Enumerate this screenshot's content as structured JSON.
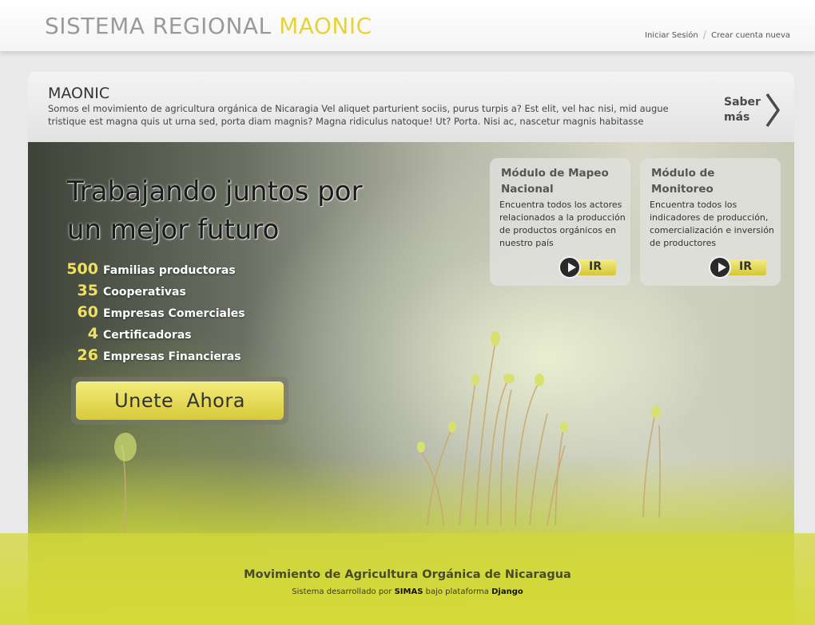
{
  "header": {
    "title_part1": "SISTEMA REGIONAL",
    "title_part2": "MAONIC",
    "login_label": "Iniciar Sesión",
    "signup_label": "Crear cuenta nueva"
  },
  "intro": {
    "title": "MAONIC",
    "text": "Somos el movimiento de agricultura orgánica de Nicaragia Vel aliquet parturient sociis, purus turpis a? Est elit, vel hac nisi, mid augue tristique est magna quis ut urna sed, porta diam magnis? Magna ridiculus natoque! Ut? Porta. Nisi ac, nascetur magnis habitasse",
    "more_label": "Saber más"
  },
  "hero": {
    "headline": "Trabajando juntos por un mejor futuro",
    "stats": [
      {
        "value": "500",
        "label": "Familias productoras"
      },
      {
        "value": "35",
        "label": "Cooperativas"
      },
      {
        "value": "60",
        "label": "Empresas Comerciales"
      },
      {
        "value": "4",
        "label": "Certificadoras"
      },
      {
        "value": "26",
        "label": "Empresas Financieras"
      }
    ],
    "join_label": "Unete  Ahora"
  },
  "modules": [
    {
      "title": "Módulo de Mapeo Nacional",
      "description": "Encuentra todos los actores relacionados a la producción de productos orgánicos en nuestro país",
      "button": "IR"
    },
    {
      "title": "Módulo de Monitoreo",
      "description": "Encuentra todos los indicadores de producción, comercialización e inversión de productores",
      "button": "IR"
    }
  ],
  "footer": {
    "title": "Movimiento de Agricultura Orgánica de Nicaragua",
    "credit_prefix": "Sistema desarrollado por",
    "credit_org": "SIMAS",
    "credit_middle": "bajo plataforma",
    "credit_platform": "Django"
  },
  "colors": {
    "accent": "#e8d23a",
    "footer": "#d4da37"
  }
}
